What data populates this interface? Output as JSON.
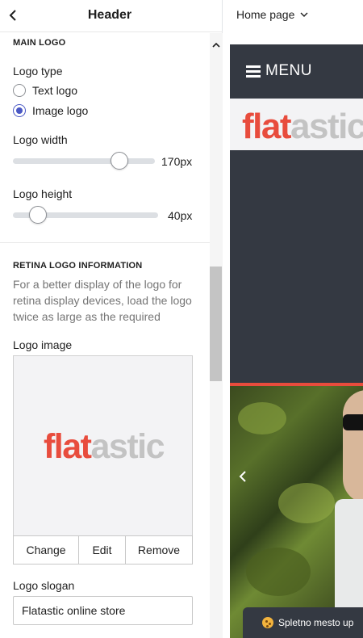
{
  "panel": {
    "title": "Header",
    "main_logo": {
      "heading": "MAIN LOGO",
      "logo_type_label": "Logo type",
      "options": [
        "Text logo",
        "Image logo"
      ],
      "selected": "Image logo",
      "logo_width_label": "Logo width",
      "logo_width_value": "170px",
      "logo_width_fraction": 0.75,
      "logo_height_label": "Logo height",
      "logo_height_value": "40px",
      "logo_height_fraction": 0.17
    },
    "retina": {
      "heading": "RETINA LOGO INFORMATION",
      "description": "For a better display of the logo for retina display devices, load the logo twice as large as the required",
      "logo_image_label": "Logo image",
      "logo_part1": "flat",
      "logo_part2": "astic",
      "buttons": [
        "Change",
        "Edit",
        "Remove"
      ],
      "slogan_label": "Logo slogan",
      "slogan_value": "Flatastic online store"
    }
  },
  "preview": {
    "page_selector": "Home page",
    "menu_label": "MENU",
    "logo_part1": "flat",
    "logo_part2": "astic",
    "cookie_text": "Spletno mesto up"
  },
  "colors": {
    "accent": "#4a58c4",
    "brand_red": "#e84c3d",
    "brand_gray": "#c3c3c3",
    "dark": "#343942"
  }
}
